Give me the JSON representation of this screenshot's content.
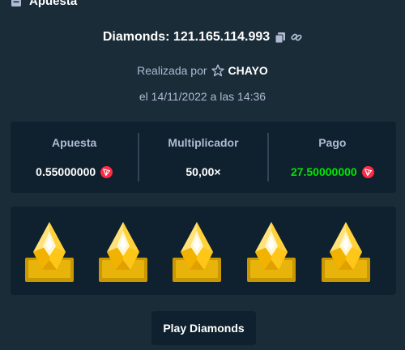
{
  "header": {
    "title": "Apuesta",
    "icon": "receipt-icon"
  },
  "game": {
    "label": "Diamonds: 121.165.114.993",
    "copy_icon": "copy-icon",
    "link_icon": "link-icon"
  },
  "placed_by": {
    "prefix": "Realizada por",
    "username": "CHAYO",
    "icon": "star-icon"
  },
  "date_text": "el 14/11/2022 a las 14:36",
  "stats": {
    "bet": {
      "label": "Apuesta",
      "value": "0.55000000",
      "currency_icon": "tron-icon"
    },
    "multiplier": {
      "label": "Multiplicador",
      "value": "50,00×"
    },
    "payout": {
      "label": "Pago",
      "value": "27.50000000",
      "currency_icon": "tron-icon"
    }
  },
  "board": {
    "gems": [
      {
        "name": "gem-icon",
        "color": "yellow"
      },
      {
        "name": "gem-icon",
        "color": "yellow"
      },
      {
        "name": "gem-icon",
        "color": "yellow"
      },
      {
        "name": "gem-icon",
        "color": "yellow"
      },
      {
        "name": "gem-icon",
        "color": "yellow"
      }
    ]
  },
  "play_button": {
    "label": "Play Diamonds"
  },
  "colors": {
    "background": "#1a2c38",
    "panel": "#0f212e",
    "divider": "#2f4553",
    "muted_text": "#b1bad3",
    "win_green": "#00e701",
    "tron_red": "#ff2a44",
    "gem_gold": "#f7c300"
  }
}
